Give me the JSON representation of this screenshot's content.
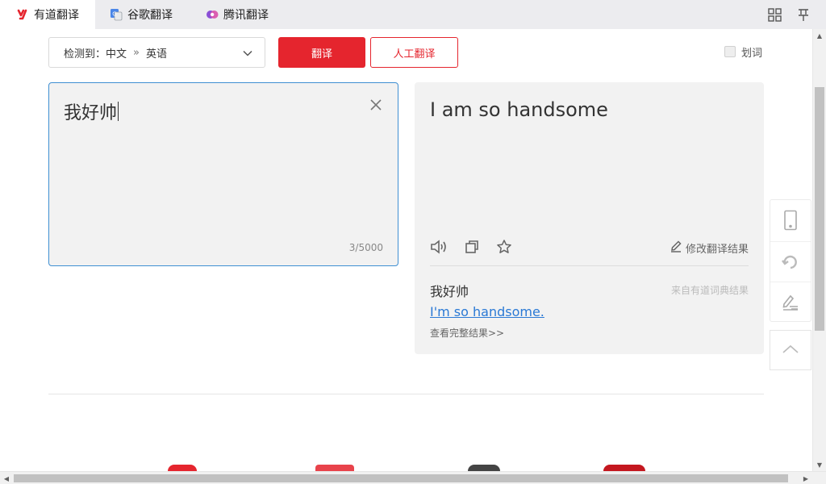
{
  "tabs": [
    {
      "label": "有道翻译",
      "icon": "youdao-logo-icon",
      "active": true
    },
    {
      "label": "谷歌翻译",
      "icon": "google-translate-icon",
      "active": false
    },
    {
      "label": "腾讯翻译",
      "icon": "tencent-translate-icon",
      "active": false
    }
  ],
  "toolbar": {
    "grid_icon": "grid-icon",
    "pin_icon": "pin-icon"
  },
  "controls": {
    "detect_label": "检测到：",
    "source_lang": "中文",
    "separator": "»",
    "target_lang": "英语",
    "translate_button": "翻译",
    "human_translate_button": "人工翻译",
    "word_pick_label": "划词"
  },
  "source": {
    "text": "我好帅",
    "char_count": "3/5000"
  },
  "result": {
    "text": "I am so handsome",
    "edit_label": "修改翻译结果",
    "dict_word": "我好帅",
    "dict_source": "来自有道词典结果",
    "dict_translation": "I'm so handsome.",
    "full_result_link": "查看完整结果>>"
  },
  "side_tools": [
    "mobile-icon",
    "refresh-icon",
    "feedback-icon"
  ],
  "back_to_top_icon": "chevron-up-icon",
  "colors": {
    "accent_red": "#e5252e",
    "link_blue": "#2a79d5",
    "focus_border": "#3f8fd2"
  }
}
